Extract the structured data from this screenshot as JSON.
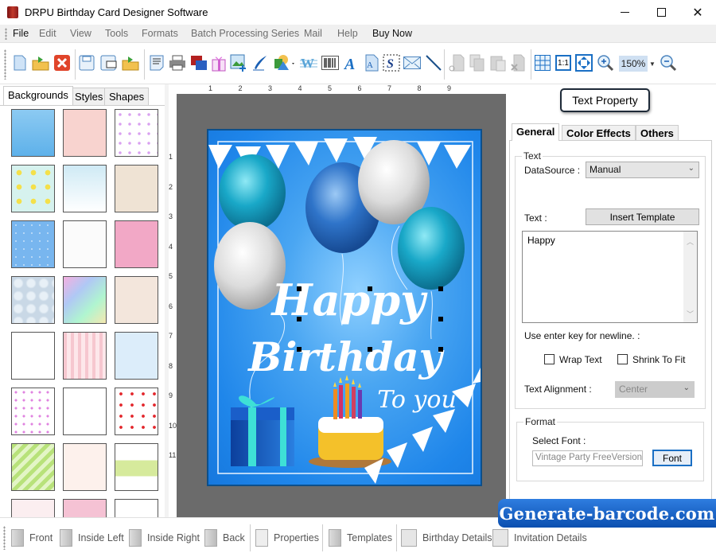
{
  "window": {
    "title": "DRPU Birthday Card Designer Software",
    "controls": [
      "minimize",
      "maximize",
      "close"
    ]
  },
  "menu": {
    "items": [
      "File",
      "Edit",
      "View",
      "Tools",
      "Formats",
      "Batch Processing Series",
      "Mail",
      "Help",
      "Buy Now"
    ]
  },
  "toolbar": {
    "buttons": [
      "new-icon",
      "open-icon",
      "close-icon",
      "save-icon",
      "save-as-icon",
      "open-template-icon",
      "properties-icon",
      "print-icon",
      "image-stack-icon",
      "gift-icon",
      "insert-image-icon",
      "pen-icon",
      "shapes-icon",
      "watermark-icon",
      "barcode-icon",
      "text-icon",
      "word-art-icon",
      "signature-icon",
      "mail-icon",
      "line-icon",
      "cut-icon",
      "copy-icon",
      "paste-icon",
      "delete-icon",
      "grid-icon",
      "actual-size-icon",
      "fit-window-icon",
      "zoom-in-icon",
      "zoom-out-icon"
    ],
    "zoom_value": "150%",
    "actual_size_label": "1:1"
  },
  "left_panel": {
    "tabs": [
      "Backgrounds",
      "Styles",
      "Shapes"
    ],
    "active_tab": "Backgrounds",
    "thumbnails": [
      "sky-clouds",
      "pink-hearts",
      "purple-butterflies",
      "flowers-daisies",
      "pastel-bears",
      "pink-bird-balloons",
      "blue-stars",
      "pastel-balloons",
      "pink-happy-birthday",
      "bubbles",
      "rainbow-swirl",
      "teddy-bear",
      "happy-birthday-text",
      "pink-hearts-stripes",
      "colorful-balloons",
      "outline-hearts",
      "balloon-bunches",
      "red-hearts",
      "green-stripes",
      "cakes-pattern",
      "green-confetti",
      "roses",
      "pink-lace",
      "sketch"
    ]
  },
  "rulers": {
    "horizontal": [
      "1",
      "2",
      "3",
      "4",
      "5",
      "6",
      "7",
      "8",
      "9"
    ],
    "vertical": [
      "1",
      "2",
      "3",
      "4",
      "5",
      "6",
      "7",
      "8",
      "9",
      "10",
      "11"
    ]
  },
  "card": {
    "line1": "Happy",
    "line2": "Birthday",
    "line3": "To you",
    "background_color": "#1f86ea"
  },
  "right_panel": {
    "header_button": "Text Property",
    "tabs": [
      "General",
      "Color Effects",
      "Others"
    ],
    "active_tab": "General",
    "text_group": {
      "legend": "Text",
      "datasource_label": "DataSource :",
      "datasource_value": "Manual",
      "text_label": "Text :",
      "insert_template_label": "Insert Template",
      "text_value": "Happy",
      "newline_hint": "Use enter key for newline. :",
      "wrap_text_label": "Wrap Text",
      "wrap_text_checked": false,
      "shrink_to_fit_label": "Shrink To Fit",
      "shrink_to_fit_checked": false,
      "alignment_label": "Text Alignment :",
      "alignment_value": "Center"
    },
    "format_group": {
      "legend": "Format",
      "select_font_label": "Select Font :",
      "font_value": "Vintage Party FreeVersion,Bo",
      "font_button": "Font"
    }
  },
  "bottom_bar": {
    "items": [
      "Front",
      "Inside Left",
      "Inside Right",
      "Back",
      "Properties",
      "Templates",
      "Birthday Details",
      "Invitation Details"
    ]
  },
  "watermark": "Generate-barcode.com"
}
